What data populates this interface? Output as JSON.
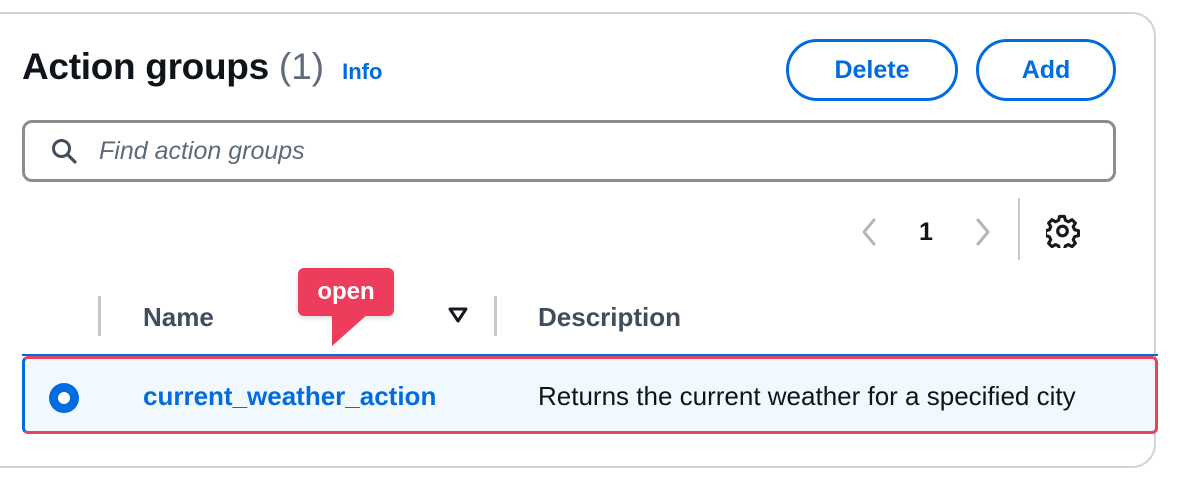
{
  "header": {
    "title": "Action groups",
    "count": "(1)",
    "info_label": "Info"
  },
  "actions": {
    "delete_label": "Delete",
    "add_label": "Add"
  },
  "search": {
    "placeholder": "Find action groups",
    "value": ""
  },
  "pagination": {
    "current_page": "1",
    "prev_icon": "chevron-left-icon",
    "next_icon": "chevron-right-icon",
    "settings_icon": "gear-icon"
  },
  "table": {
    "columns": [
      "Name",
      "Description"
    ],
    "rows": [
      {
        "selected": true,
        "name": "current_weather_action",
        "description": "Returns the current weather for a specified city"
      }
    ]
  },
  "annotation": {
    "label": "open",
    "color": "#ee3d5c"
  },
  "colors": {
    "accent": "#006ce0",
    "selected_row_bg": "#f1f9ff",
    "highlight_border": "#e8435c"
  }
}
